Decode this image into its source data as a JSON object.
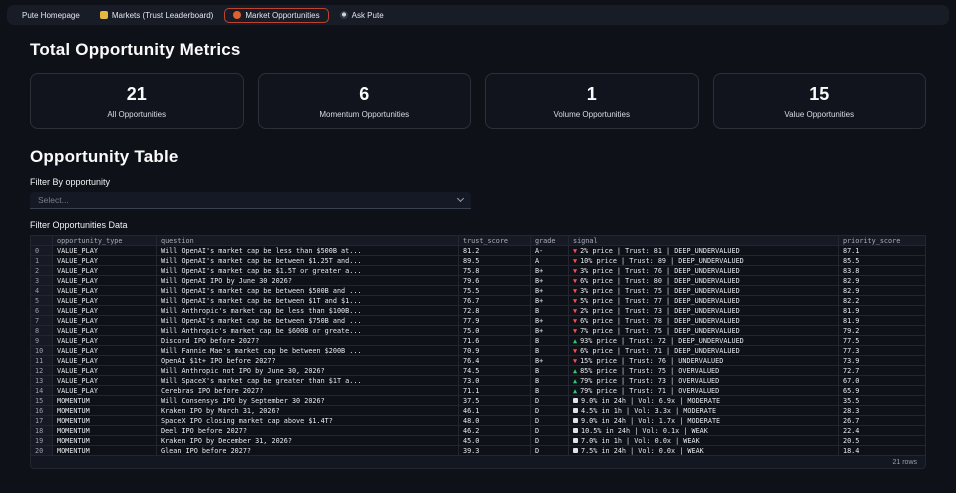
{
  "nav": {
    "items": [
      {
        "label": "Pute Homepage",
        "icon": "none",
        "active": false
      },
      {
        "label": "Markets (Trust Leaderboard)",
        "icon": "trophy",
        "active": false
      },
      {
        "label": "Market Opportunities",
        "icon": "flame",
        "active": true
      },
      {
        "label": "Ask Pute",
        "icon": "chat",
        "active": false
      }
    ]
  },
  "colors": {
    "active_tab_border": "#bf4430",
    "signal_down": "#ff4b4b",
    "signal_up": "#2ecc71"
  },
  "metrics": {
    "title": "Total Opportunity Metrics",
    "cards": [
      {
        "value": "21",
        "label": "All Opportunities"
      },
      {
        "value": "6",
        "label": "Momentum Opportunities"
      },
      {
        "value": "1",
        "label": "Volume Opportunities"
      },
      {
        "value": "15",
        "label": "Value Opportunities"
      }
    ]
  },
  "table_section": {
    "title": "Opportunity Table",
    "filter_label": "Filter By opportunity",
    "select_placeholder": "Select...",
    "data_label": "Filter Opportunities Data",
    "footer": "21 rows",
    "columns": [
      "",
      "opportunity_type",
      "question",
      "trust_score",
      "grade",
      "signal",
      "priority_score"
    ],
    "rows": [
      {
        "idx": "0",
        "type": "VALUE_PLAY",
        "question": "Will OpenAI's market cap be less than $500B at...",
        "trust": "81.2",
        "grade": "A-",
        "signal_icon": "down",
        "signal": "2% price | Trust: 81 | DEEP_UNDERVALUED",
        "priority": "87.1"
      },
      {
        "idx": "1",
        "type": "VALUE_PLAY",
        "question": "Will OpenAI's market cap be between $1.25T and...",
        "trust": "89.5",
        "grade": "A",
        "signal_icon": "down",
        "signal": "10% price | Trust: 89 | DEEP_UNDERVALUED",
        "priority": "85.5"
      },
      {
        "idx": "2",
        "type": "VALUE_PLAY",
        "question": "Will OpenAI's market cap be $1.5T or greater a...",
        "trust": "75.8",
        "grade": "B+",
        "signal_icon": "down",
        "signal": "3% price | Trust: 76 | DEEP_UNDERVALUED",
        "priority": "83.8"
      },
      {
        "idx": "3",
        "type": "VALUE_PLAY",
        "question": "Will OpenAI IPO by June 30 2026?",
        "trust": "79.6",
        "grade": "B+",
        "signal_icon": "down",
        "signal": "6% price | Trust: 80 | DEEP_UNDERVALUED",
        "priority": "82.9"
      },
      {
        "idx": "4",
        "type": "VALUE_PLAY",
        "question": "Will OpenAI's market cap be between $500B and ...",
        "trust": "75.5",
        "grade": "B+",
        "signal_icon": "down",
        "signal": "3% price | Trust: 75 | DEEP_UNDERVALUED",
        "priority": "82.9"
      },
      {
        "idx": "5",
        "type": "VALUE_PLAY",
        "question": "Will OpenAI's market cap be between $1T and $1...",
        "trust": "76.7",
        "grade": "B+",
        "signal_icon": "down",
        "signal": "5% price | Trust: 77 | DEEP_UNDERVALUED",
        "priority": "82.2"
      },
      {
        "idx": "6",
        "type": "VALUE_PLAY",
        "question": "Will Anthropic's market cap be less than $100B...",
        "trust": "72.8",
        "grade": "B",
        "signal_icon": "down",
        "signal": "2% price | Trust: 73 | DEEP_UNDERVALUED",
        "priority": "81.9"
      },
      {
        "idx": "7",
        "type": "VALUE_PLAY",
        "question": "Will OpenAI's market cap be between $750B and ...",
        "trust": "77.9",
        "grade": "B+",
        "signal_icon": "down",
        "signal": "6% price | Trust: 78 | DEEP_UNDERVALUED",
        "priority": "81.9"
      },
      {
        "idx": "8",
        "type": "VALUE_PLAY",
        "question": "Will Anthropic's market cap be $600B or greate...",
        "trust": "75.0",
        "grade": "B+",
        "signal_icon": "down",
        "signal": "7% price | Trust: 75 | DEEP_UNDERVALUED",
        "priority": "79.2"
      },
      {
        "idx": "9",
        "type": "VALUE_PLAY",
        "question": "Discord IPO before 2027?",
        "trust": "71.6",
        "grade": "B",
        "signal_icon": "up",
        "signal": "93% price | Trust: 72 | DEEP_UNDERVALUED",
        "priority": "77.5"
      },
      {
        "idx": "10",
        "type": "VALUE_PLAY",
        "question": "Will Fannie Mae's market cap be between $200B ...",
        "trust": "70.9",
        "grade": "B",
        "signal_icon": "down",
        "signal": "6% price | Trust: 71 | DEEP_UNDERVALUED",
        "priority": "77.3"
      },
      {
        "idx": "11",
        "type": "VALUE_PLAY",
        "question": "OpenAI $1t+ IPO before 2027?",
        "trust": "76.4",
        "grade": "B+",
        "signal_icon": "down",
        "signal": "15% price | Trust: 76 | UNDERVALUED",
        "priority": "73.9"
      },
      {
        "idx": "12",
        "type": "VALUE_PLAY",
        "question": "Will Anthropic not IPO by June 30, 2026?",
        "trust": "74.5",
        "grade": "B",
        "signal_icon": "up",
        "signal": "85% price | Trust: 75 | OVERVALUED",
        "priority": "72.7"
      },
      {
        "idx": "13",
        "type": "VALUE_PLAY",
        "question": "Will SpaceX's market cap be greater than $1T a...",
        "trust": "73.0",
        "grade": "B",
        "signal_icon": "up",
        "signal": "79% price | Trust: 73 | OVERVALUED",
        "priority": "67.0"
      },
      {
        "idx": "14",
        "type": "VALUE_PLAY",
        "question": "Cerebras IPO before 2027?",
        "trust": "71.1",
        "grade": "B",
        "signal_icon": "up",
        "signal": "79% price | Trust: 71 | OVERVALUED",
        "priority": "65.9"
      },
      {
        "idx": "15",
        "type": "MOMENTUM",
        "question": "Will Consensys IPO by September 30 2026?",
        "trust": "37.5",
        "grade": "D",
        "signal_icon": "box",
        "signal": "9.0% in 24h | Vol: 6.9x | MODERATE",
        "priority": "35.5"
      },
      {
        "idx": "16",
        "type": "MOMENTUM",
        "question": "Kraken IPO by March 31, 2026?",
        "trust": "46.1",
        "grade": "D",
        "signal_icon": "box",
        "signal": "4.5% in 1h | Vol: 3.3x | MODERATE",
        "priority": "28.3"
      },
      {
        "idx": "17",
        "type": "MOMENTUM",
        "question": "SpaceX IPO closing market cap above $1.4T?",
        "trust": "48.0",
        "grade": "D",
        "signal_icon": "box",
        "signal": "9.0% in 24h | Vol: 1.7x | MODERATE",
        "priority": "26.7"
      },
      {
        "idx": "18",
        "type": "MOMENTUM",
        "question": "Deel IPO before 2027?",
        "trust": "46.2",
        "grade": "D",
        "signal_icon": "box",
        "signal": "10.5% in 24h | Vol: 0.1x | WEAK",
        "priority": "22.4"
      },
      {
        "idx": "19",
        "type": "MOMENTUM",
        "question": "Kraken IPO by December 31, 2026?",
        "trust": "45.0",
        "grade": "D",
        "signal_icon": "box",
        "signal": "7.0% in 1h | Vol: 0.0x | WEAK",
        "priority": "20.5"
      },
      {
        "idx": "20",
        "type": "MOMENTUM",
        "question": "Glean IPO before 2027?",
        "trust": "39.3",
        "grade": "D",
        "signal_icon": "box",
        "signal": "7.5% in 24h | Vol: 0.0x | WEAK",
        "priority": "18.4"
      }
    ]
  }
}
